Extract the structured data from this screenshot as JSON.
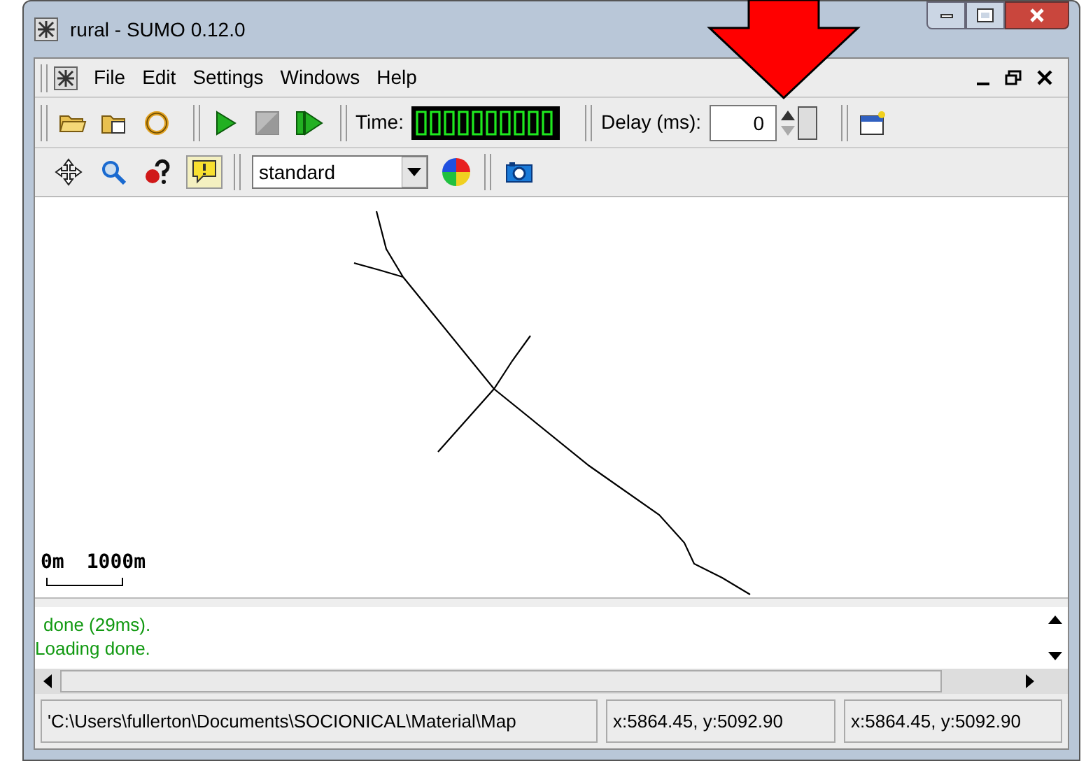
{
  "window": {
    "title": "rural - SUMO 0.12.0"
  },
  "menu": [
    "File",
    "Edit",
    "Settings",
    "Windows",
    "Help"
  ],
  "toolbar": {
    "time_label": "Time:",
    "delay_label": "Delay (ms):",
    "delay_value": "0"
  },
  "view_toolbar": {
    "scheme": "standard"
  },
  "log": [
    {
      "text": "done (29ms).",
      "indent": true
    },
    {
      "text": "Loading done.",
      "indent": false
    }
  ],
  "scale": {
    "start": "0m",
    "end": "1000m"
  },
  "status_bar": [
    "'C:\\Users\\fullerton\\Documents\\SOCIONICAL\\Material\\Map",
    "x:5864.45, y:5092.90",
    "x:5864.45, y:5092.90"
  ]
}
